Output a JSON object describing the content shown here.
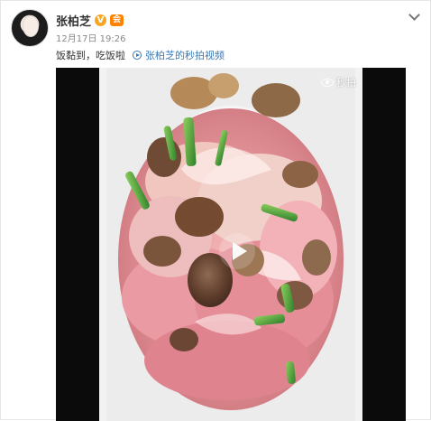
{
  "post": {
    "author": "张柏芝",
    "verified_mark": "V",
    "vip_badge": "会",
    "timestamp": "12月17日 19:26",
    "text": "饭黏到，吃饭啦",
    "video_link_label": "张柏芝的秒拍视频"
  },
  "video": {
    "watermark": "秒拍"
  },
  "icons": {
    "more": "chevron-down-icon",
    "verified": "verified-icon",
    "vip": "vip-badge-icon",
    "video_link": "video-link-icon",
    "watermark": "eye-icon",
    "play": "play-icon"
  },
  "colors": {
    "link": "#3a78b3",
    "verified": "#f6a623",
    "vip": "#ff8200"
  }
}
